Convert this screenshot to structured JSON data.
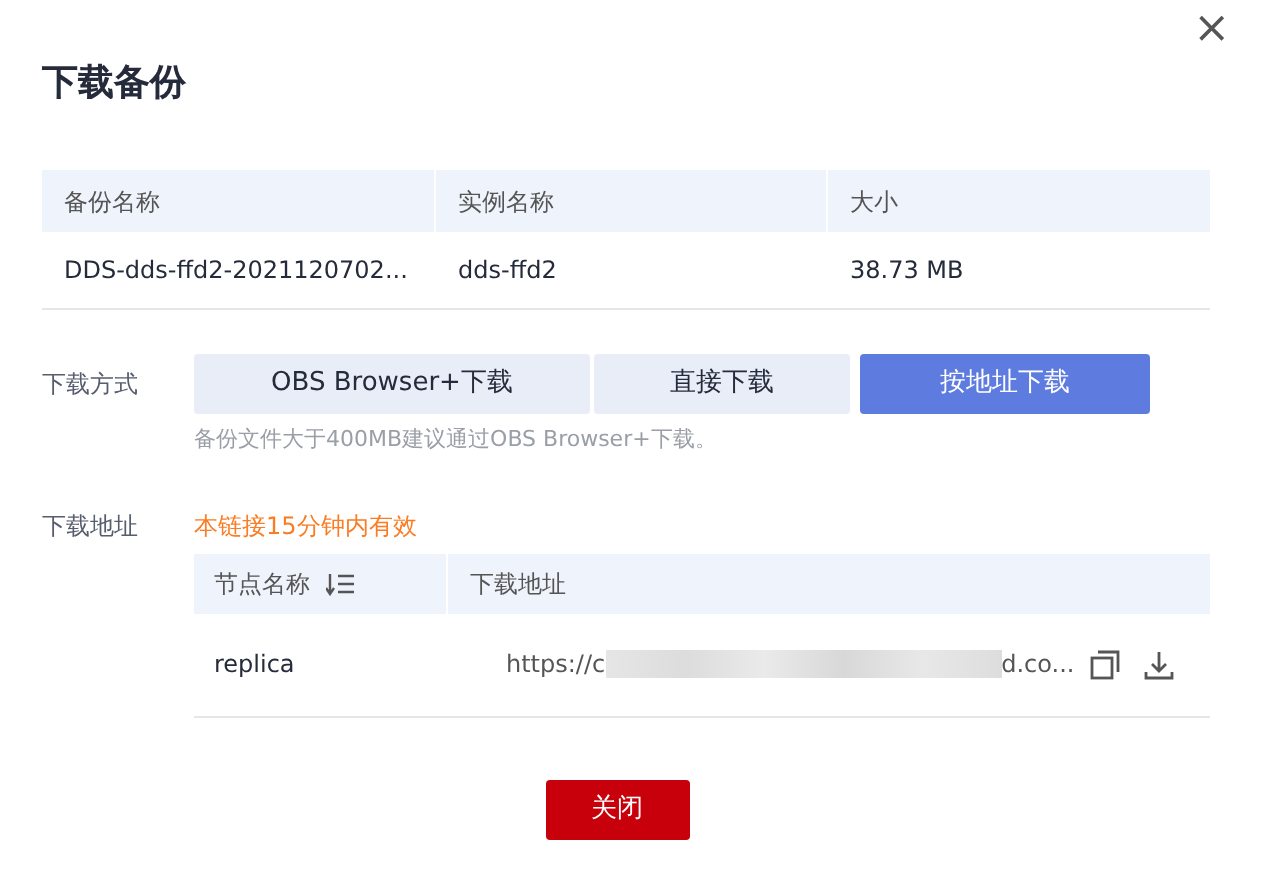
{
  "dialog": {
    "title": "下载备份",
    "close_icon": "×"
  },
  "backup_table": {
    "columns": [
      "备份名称",
      "实例名称",
      "大小"
    ],
    "rows": [
      [
        "DDS-dds-ffd2-2021120702...",
        "dds-ffd2",
        "38.73 MB"
      ]
    ]
  },
  "download_method": {
    "label": "下载方式",
    "options": [
      {
        "label": "OBS Browser+下载",
        "selected": false
      },
      {
        "label": "直接下载",
        "selected": false
      },
      {
        "label": "按地址下载",
        "selected": true
      }
    ],
    "hint": "备份文件大于400MB建议通过OBS Browser+下载。"
  },
  "download_address": {
    "label": "下载地址",
    "notice": "本链接15分钟内有效",
    "columns": [
      "节点名称",
      "下载地址"
    ],
    "rows": [
      {
        "node": "replica",
        "url_start": "https://c",
        "url_end": "d.co..."
      }
    ]
  },
  "buttons": [
    "关闭"
  ]
}
